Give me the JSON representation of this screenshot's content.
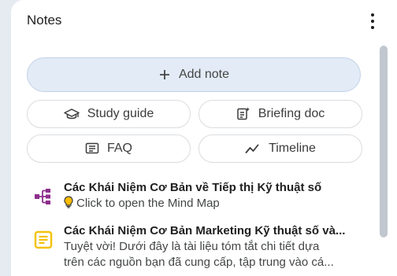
{
  "header": {
    "title": "Notes",
    "menu_icon": "more-vert-icon"
  },
  "actions": {
    "add_note_icon": "plus-icon",
    "add_note_label": "Add note",
    "study_guide_icon": "graduation-cap-icon",
    "study_guide_label": "Study guide",
    "briefing_doc_icon": "document-sparkle-icon",
    "briefing_doc_label": "Briefing doc",
    "faq_icon": "list-box-icon",
    "faq_label": "FAQ",
    "timeline_icon": "trend-line-icon",
    "timeline_label": "Timeline"
  },
  "notes": [
    {
      "icon": "mind-map-icon",
      "icon_color": "#8e2f8c",
      "title": "Các Khái Niệm Cơ Bản về Tiếp thị Kỹ thuật số",
      "subtitle_icon": "lightbulb-icon",
      "subtitle": "Click to open the Mind Map"
    },
    {
      "icon": "note-icon",
      "icon_color": "#f4c20d",
      "title": "Các Khái Niệm Cơ Bản Marketing Kỹ thuật số và...",
      "snippet_line1": "Tuyệt vời! Dưới đây là tài liệu tóm tắt chi tiết dựa",
      "snippet_line2": "trên các nguồn bạn đã cung cấp, tập trung vào cá..."
    }
  ],
  "colors": {
    "panel_bg": "#ffffff",
    "page_bg": "#e6ebf1",
    "add_note_bg": "#e3ebf6",
    "pill_border": "#dadce0"
  }
}
